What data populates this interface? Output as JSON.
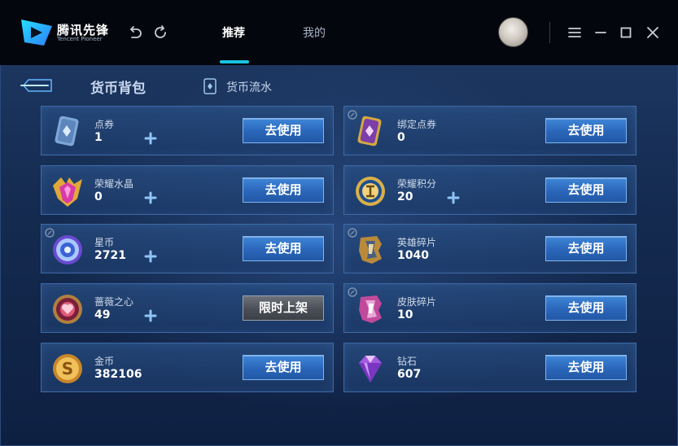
{
  "app": {
    "logo_text": "腾讯先锋",
    "logo_sub": "Tencent Pioneer"
  },
  "nav": {
    "tabs": [
      {
        "label": "推荐",
        "active": true
      },
      {
        "label": "我的",
        "active": false
      }
    ]
  },
  "header": {
    "title": "货币背包",
    "flow_link": "货币流水"
  },
  "colors": {
    "accent": "#19c3e0",
    "button_blue": "#2a66b9",
    "button_gray": "#4a4e56"
  },
  "currencies": [
    {
      "name": "点券",
      "value": "1",
      "has_plus": true,
      "action": "去使用",
      "icon": "ticket-card-icon"
    },
    {
      "name": "绑定点券",
      "value": "0",
      "has_plus": false,
      "action": "去使用",
      "icon": "bound-ticket-card-icon"
    },
    {
      "name": "荣耀水晶",
      "value": "0",
      "has_plus": true,
      "action": "去使用",
      "icon": "glory-crystal-icon"
    },
    {
      "name": "荣耀积分",
      "value": "20",
      "has_plus": true,
      "action": "去使用",
      "icon": "glory-points-icon"
    },
    {
      "name": "星币",
      "value": "2721",
      "has_plus": true,
      "action": "去使用",
      "icon": "star-coin-icon"
    },
    {
      "name": "英雄碎片",
      "value": "1040",
      "has_plus": false,
      "action": "去使用",
      "icon": "hero-fragment-icon"
    },
    {
      "name": "蔷薇之心",
      "value": "49",
      "has_plus": true,
      "action": "限时上架",
      "icon": "rose-heart-icon"
    },
    {
      "name": "皮肤碎片",
      "value": "10",
      "has_plus": false,
      "action": "去使用",
      "icon": "skin-fragment-icon"
    },
    {
      "name": "金币",
      "value": "382106",
      "has_plus": false,
      "action": "去使用",
      "icon": "gold-coin-icon"
    },
    {
      "name": "钻石",
      "value": "607",
      "has_plus": false,
      "action": "去使用",
      "icon": "diamond-icon"
    }
  ]
}
